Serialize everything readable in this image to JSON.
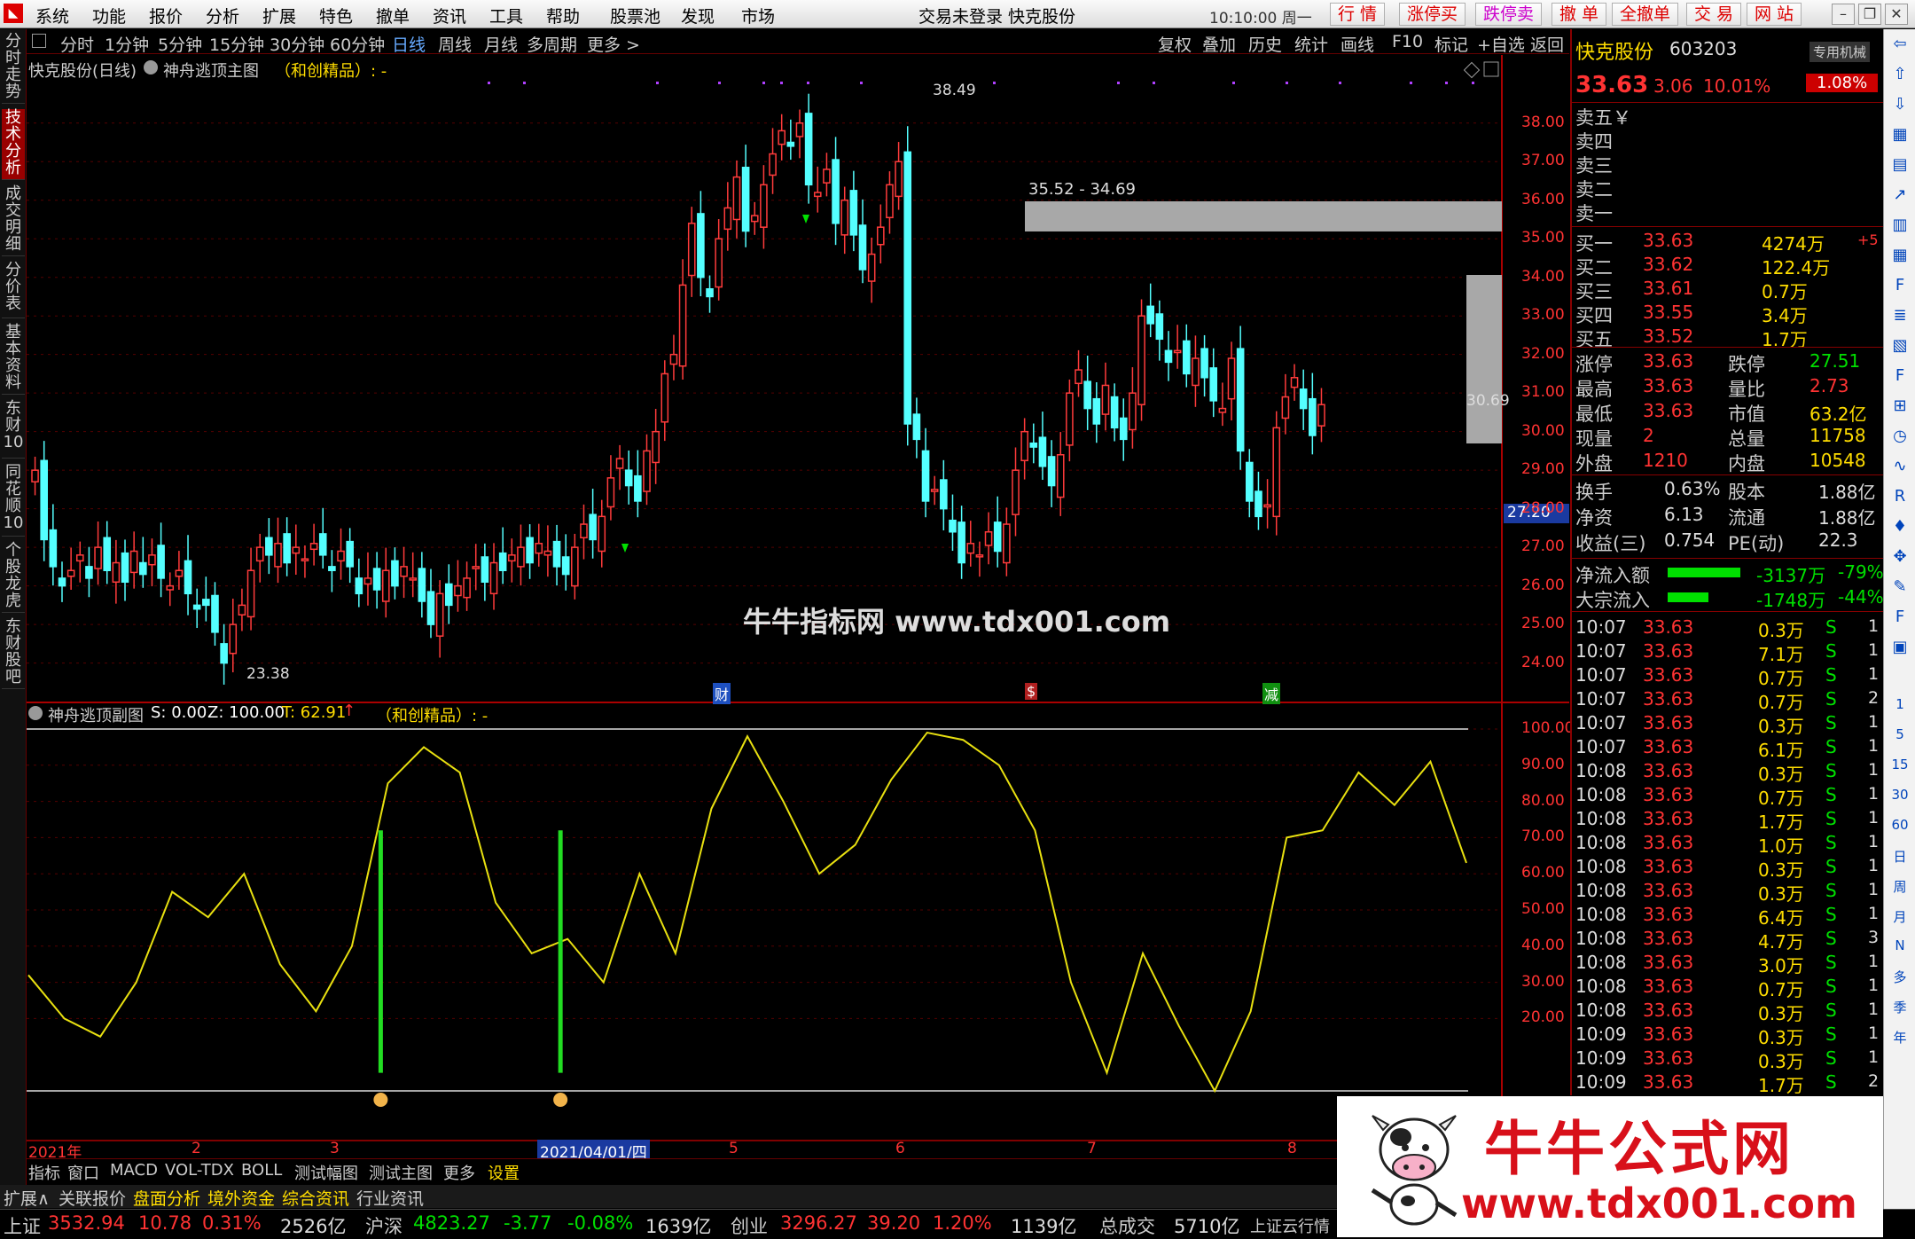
{
  "menu": [
    "系统",
    "功能",
    "报价",
    "分析",
    "扩展",
    "特色",
    "撤单",
    "资讯",
    "工具",
    "帮助"
  ],
  "menu_red": [
    "股票池",
    "发现",
    "市场"
  ],
  "title": "交易未登录 快克股份",
  "clock": "10:10:00 周一",
  "top_right": [
    "行 情",
    "涨停买",
    "跌停卖",
    "撤 单",
    "全撤单",
    "交 易",
    "网 站"
  ],
  "periods": [
    "分时",
    "1分钟",
    "5分钟",
    "15分钟",
    "30分钟",
    "60分钟",
    "日线",
    "周线",
    "月线",
    "多周期",
    "更多 >"
  ],
  "tools": [
    "复权",
    "叠加",
    "历史",
    "统计",
    "画线",
    "F10",
    "标记",
    "+自选",
    "返回"
  ],
  "left_tabs": [
    "分时走势",
    "技术分析",
    "成交明细",
    "分价表",
    "基本资料",
    "东财10",
    "同花顺10",
    "个股龙虎",
    "东财股吧"
  ],
  "main_chart": {
    "stock": "快克股份(日线)",
    "indicator": "神舟逃顶主图",
    "tag": "（和创精品）: -",
    "high_label": "38.49",
    "low_label": "23.38",
    "zone_label": "35.52 - 34.69",
    "last_label": "30.69",
    "cursor_price": "27.20",
    "yticks": [
      "38.00",
      "37.00",
      "36.00",
      "35.00",
      "34.00",
      "33.00",
      "32.00",
      "31.00",
      "30.00",
      "29.00",
      "28.00",
      "27.00",
      "26.00",
      "25.00",
      "24.00"
    ],
    "markers": [
      "财",
      "$",
      "减"
    ],
    "watermark": "牛牛指标网 www.tdx001.com"
  },
  "sub_chart": {
    "title": "神舟逃顶副图",
    "s": "S: 0.00",
    "z": "Z: 100.00",
    "t": "T: 62.91",
    "tag": "（和创精品）: -",
    "yticks": [
      "100.00",
      "90.00",
      "80.00",
      "70.00",
      "60.00",
      "50.00",
      "40.00",
      "30.00",
      "20.00"
    ]
  },
  "xaxis": {
    "year": "2021年",
    "date_box": "2021/04/01/四",
    "months": [
      "2",
      "3",
      "5",
      "6",
      "7",
      "8"
    ]
  },
  "chart_data": {
    "type": "line",
    "title": "神舟逃顶副图",
    "x": [
      0,
      5,
      10,
      15,
      20,
      25,
      30,
      35,
      40,
      45,
      50,
      55,
      60,
      65,
      70,
      75,
      80,
      85,
      90,
      95,
      100,
      105,
      110,
      115,
      120,
      125,
      130,
      135,
      140,
      145,
      150,
      155,
      160,
      165,
      170,
      175,
      180,
      185,
      190,
      195,
      200
    ],
    "series": [
      {
        "name": "T",
        "values": [
          32,
          20,
          15,
          30,
          55,
          48,
          60,
          35,
          22,
          40,
          85,
          95,
          88,
          52,
          38,
          42,
          30,
          60,
          38,
          78,
          98,
          80,
          60,
          68,
          86,
          99,
          97,
          90,
          72,
          30,
          5,
          38,
          18,
          0,
          22,
          70,
          72,
          88,
          79,
          91,
          63
        ]
      }
    ],
    "ylim": [
      0,
      100
    ],
    "buy_signals_x": [
      49,
      74
    ]
  },
  "quote": {
    "name": "快克股份",
    "code": "603203",
    "badge": "专用机械",
    "price": "33.63",
    "change": "3.06",
    "pct": "10.01%",
    "pct2": "1.08%",
    "sells": [
      "卖五￥",
      "卖四",
      "卖三",
      "卖二",
      "卖一"
    ],
    "buys": [
      {
        "l": "买一",
        "p": "33.63",
        "v": "4274万",
        "x": "+5"
      },
      {
        "l": "买二",
        "p": "33.62",
        "v": "122.4万",
        "x": ""
      },
      {
        "l": "买三",
        "p": "33.61",
        "v": "0.7万",
        "x": ""
      },
      {
        "l": "买四",
        "p": "33.55",
        "v": "3.4万",
        "x": ""
      },
      {
        "l": "买五",
        "p": "33.52",
        "v": "1.7万",
        "x": ""
      }
    ],
    "stats": [
      {
        "a": "涨停",
        "av": "33.63",
        "b": "跌停",
        "bv": "27.51"
      },
      {
        "a": "最高",
        "av": "33.63",
        "b": "量比",
        "bv": "2.73"
      },
      {
        "a": "最低",
        "av": "33.63",
        "b": "市值",
        "bv": "63.2亿"
      },
      {
        "a": "现量",
        "av": "2",
        "b": "总量",
        "bv": "11758"
      },
      {
        "a": "外盘",
        "av": "1210",
        "b": "内盘",
        "bv": "10548"
      }
    ],
    "stats2": [
      {
        "a": "换手",
        "av": "0.63%",
        "b": "股本",
        "bv": "1.88亿"
      },
      {
        "a": "净资",
        "av": "6.13",
        "b": "流通",
        "bv": "1.88亿"
      },
      {
        "a": "收益(三)",
        "av": "0.754",
        "b": "PE(动)",
        "bv": "22.3"
      }
    ],
    "flow": [
      {
        "l": "净流入额",
        "v": "-3137万",
        "p": "-79%"
      },
      {
        "l": "大宗流入",
        "v": "-1748万",
        "p": "-44%"
      }
    ],
    "ticks": [
      [
        "10:07",
        "33.63",
        "0.3万",
        "S",
        "1"
      ],
      [
        "10:07",
        "33.63",
        "7.1万",
        "S",
        "1"
      ],
      [
        "10:07",
        "33.63",
        "0.7万",
        "S",
        "1"
      ],
      [
        "10:07",
        "33.63",
        "0.7万",
        "S",
        "2"
      ],
      [
        "10:07",
        "33.63",
        "0.3万",
        "S",
        "1"
      ],
      [
        "10:07",
        "33.63",
        "6.1万",
        "S",
        "1"
      ],
      [
        "10:08",
        "33.63",
        "0.3万",
        "S",
        "1"
      ],
      [
        "10:08",
        "33.63",
        "0.7万",
        "S",
        "1"
      ],
      [
        "10:08",
        "33.63",
        "1.7万",
        "S",
        "1"
      ],
      [
        "10:08",
        "33.63",
        "1.0万",
        "S",
        "1"
      ],
      [
        "10:08",
        "33.63",
        "0.3万",
        "S",
        "1"
      ],
      [
        "10:08",
        "33.63",
        "0.3万",
        "S",
        "1"
      ],
      [
        "10:08",
        "33.63",
        "6.4万",
        "S",
        "1"
      ],
      [
        "10:08",
        "33.63",
        "4.7万",
        "S",
        "3"
      ],
      [
        "10:08",
        "33.63",
        "3.0万",
        "S",
        "1"
      ],
      [
        "10:08",
        "33.63",
        "0.7万",
        "S",
        "1"
      ],
      [
        "10:08",
        "33.63",
        "0.3万",
        "S",
        "1"
      ],
      [
        "10:09",
        "33.63",
        "0.3万",
        "S",
        "1"
      ],
      [
        "10:09",
        "33.63",
        "0.3万",
        "S",
        "1"
      ],
      [
        "10:09",
        "33.63",
        "1.7万",
        "S",
        "2"
      ]
    ]
  },
  "right_icons": [
    "1",
    "5",
    "15",
    "30",
    "60",
    "日",
    "周",
    "月",
    "N",
    "多",
    "季",
    "年"
  ],
  "bottom_tabs": [
    "指标",
    "窗口",
    "MACD",
    "VOL-TDX",
    "BOLL",
    "测试幅图",
    "测试主图",
    "更多",
    "设置"
  ],
  "bottom2": [
    "扩展∧",
    "关联报价",
    "盘面分析",
    "境外资金",
    "综合资讯",
    "行业资讯"
  ],
  "status": {
    "sh": "上证",
    "sh_v": "3532.94",
    "sh_c": "10.78",
    "sh_p": "0.31%",
    "sh_a": "2526亿",
    "hs": "沪深",
    "hs_v": "4823.27",
    "hs_c": "-3.77",
    "hs_p": "-0.08%",
    "hs_a": "1639亿",
    "cy": "创业",
    "cy_v": "3296.27",
    "cy_c": "39.20",
    "cy_p": "1.20%",
    "cy_a": "1139亿",
    "tot": "总成交",
    "tot_v": "5710亿",
    "news": "上证云行情"
  },
  "ad": {
    "title": "牛牛公式网",
    "url": "www.tdx001.com"
  }
}
